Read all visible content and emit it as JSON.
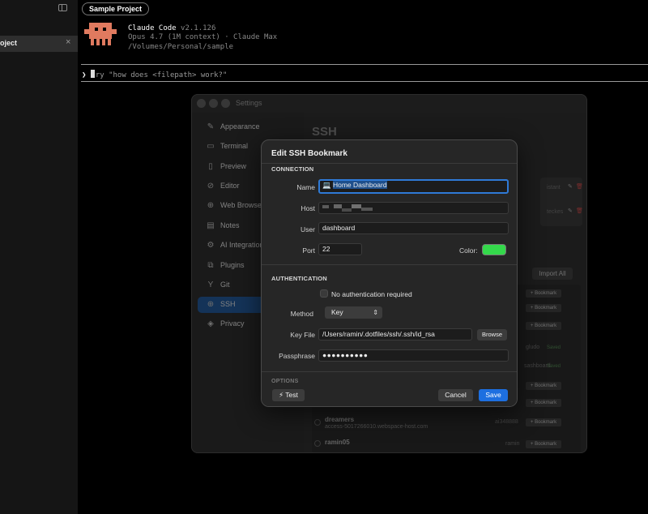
{
  "sidebar": {
    "project_label": "oject",
    "close_glyph": "×"
  },
  "terminal": {
    "tab_label": "Sample Project",
    "product_name": "Claude Code",
    "version": "v2.1.126",
    "model_line": "Opus 4.7 (1M context) · Claude Max",
    "path": "/Volumes/Personal/sample",
    "prompt_chevron": "❯",
    "prompt_placeholder": "ry \"how does <filepath> work?\"",
    "mascot_color": "#e07a5f"
  },
  "settings": {
    "title": "Settings",
    "heading": "SSH",
    "nav": [
      {
        "label": "Appearance",
        "icon": "paintbrush-icon",
        "glyph": "✎"
      },
      {
        "label": "Terminal",
        "icon": "terminal-icon",
        "glyph": "▭"
      },
      {
        "label": "Preview",
        "icon": "document-icon",
        "glyph": "▯"
      },
      {
        "label": "Editor",
        "icon": "editor-icon",
        "glyph": "⊘"
      },
      {
        "label": "Web Browser",
        "icon": "globe-icon",
        "glyph": "⊕"
      },
      {
        "label": "Notes",
        "icon": "notes-icon",
        "glyph": "▤"
      },
      {
        "label": "AI Integration",
        "icon": "ai-icon",
        "glyph": "⚙"
      },
      {
        "label": "Plugins",
        "icon": "plugin-icon",
        "glyph": "⧉"
      },
      {
        "label": "Git",
        "icon": "git-icon",
        "glyph": "Y"
      },
      {
        "label": "SSH",
        "icon": "ssh-globe-icon",
        "glyph": "⊕",
        "active": true
      },
      {
        "label": "Privacy",
        "icon": "shield-icon",
        "glyph": "◈"
      }
    ],
    "card_texts": [
      "istant",
      "teckes"
    ],
    "import_all_label": "Import All",
    "bookmark_button_label": "+ Bookmark",
    "list": {
      "saved_label": "Saved",
      "users": [
        "gludo",
        "sashboard"
      ],
      "items": [
        {
          "name": "dreamers",
          "sub": "access-5017266010.webspace-host.com",
          "user": "ai348888"
        },
        {
          "name": "ramin05",
          "sub": "",
          "user": "ramin"
        }
      ]
    }
  },
  "dialog": {
    "title": "Edit SSH Bookmark",
    "connection_label": "CONNECTION",
    "authentication_label": "AUTHENTICATION",
    "options_label": "OPTIONS",
    "name": {
      "label": "Name",
      "value": "Home Dashboard",
      "emoji": "💻"
    },
    "host": {
      "label": "Host"
    },
    "user": {
      "label": "User",
      "value": "dashboard"
    },
    "port": {
      "label": "Port",
      "value": "22"
    },
    "color": {
      "label": "Color:",
      "value": "#34d94b"
    },
    "no_auth": {
      "label": "No authentication required",
      "checked": false
    },
    "method": {
      "label": "Method",
      "value": "Key",
      "chevron": "⌃⌄"
    },
    "key_file": {
      "label": "Key File",
      "value": "/Users/ramin/.dotfiles/ssh/.ssh/id_rsa",
      "browse_label": "Browse"
    },
    "passphrase": {
      "label": "Passphrase",
      "value": "●●●●●●●●●●"
    },
    "test_label": "⚡ Test",
    "cancel_label": "Cancel",
    "save_label": "Save",
    "accent_color": "#1d6fe0"
  }
}
